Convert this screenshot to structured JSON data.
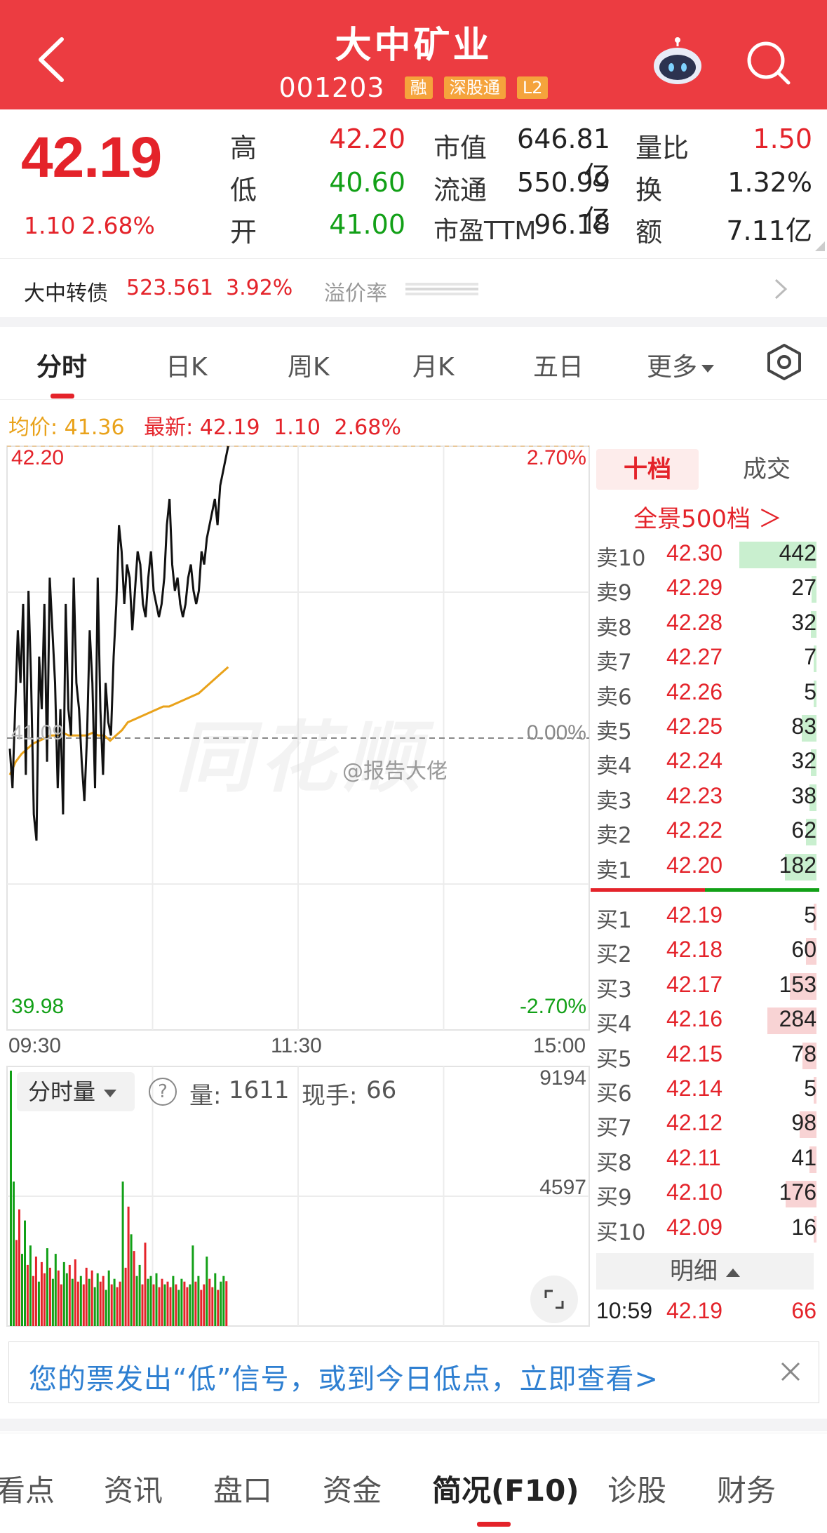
{
  "header": {
    "title": "大中矿业",
    "code": "001203",
    "tags": [
      "融",
      "深股通",
      "L2"
    ]
  },
  "quote": {
    "price": "42.19",
    "change": "1.10",
    "change_pct": "2.68%",
    "high_label": "高",
    "high": "42.20",
    "low_label": "低",
    "low": "40.60",
    "open_label": "开",
    "open": "41.00",
    "mcap_label": "市值",
    "mcap": "646.81亿",
    "float_label": "流通",
    "float": "550.99亿",
    "pe_label": "市盈TTM",
    "pe": "96.18",
    "vr_label": "量比",
    "vr": "1.50",
    "turnover_label": "换",
    "turnover": "1.32%",
    "amount_label": "额",
    "amount": "7.11亿"
  },
  "convertible": {
    "label": "大中转债",
    "price": "523.561",
    "pct": "3.92%",
    "premium_label": "溢价率"
  },
  "tabs": [
    "分时",
    "日K",
    "周K",
    "月K",
    "五日",
    "更多"
  ],
  "avg_bar": {
    "avg_label": "均价:",
    "avg": "41.36",
    "last_label": "最新:",
    "last": "42.19",
    "chg": "1.10",
    "pct": "2.68%"
  },
  "chart_data": {
    "type": "line",
    "title": "",
    "y_left_ticks": [
      "42.20",
      "41.09",
      "39.98"
    ],
    "y_right_ticks": [
      "2.70%",
      "0.00%",
      "-2.70%"
    ],
    "x_ticks": [
      "09:30",
      "11:30",
      "15:00"
    ],
    "ylim": [
      39.98,
      42.2
    ],
    "reference_close": 41.09,
    "series": [
      {
        "values": [
          41.05,
          40.9,
          41.2,
          41.5,
          41.3,
          41.6,
          40.95,
          41.65,
          41.3,
          40.8,
          40.7,
          41.4,
          41.2,
          41.6,
          41.0,
          41.7,
          41.5,
          41.3,
          40.9,
          41.2,
          40.8,
          41.6,
          41.2,
          41.1,
          41.7,
          41.3,
          41.2,
          41.0,
          40.85,
          41.1,
          41.5,
          41.3,
          40.9,
          41.7,
          41.2,
          40.95,
          41.3,
          41.15,
          41.1,
          41.4,
          41.6,
          41.9,
          41.8,
          41.6,
          41.75,
          41.7,
          41.5,
          41.65,
          41.8,
          41.75,
          41.6,
          41.55,
          41.7,
          41.8,
          41.65,
          41.6,
          41.55,
          41.6,
          41.7,
          41.9,
          42.0,
          41.75,
          41.65,
          41.7,
          41.6,
          41.55,
          41.6,
          41.7,
          41.75,
          41.65,
          41.6,
          41.65,
          41.8,
          41.75,
          41.85,
          41.9,
          41.95,
          42.0,
          41.9,
          42.05,
          42.1,
          42.15,
          42.2
        ]
      },
      {
        "values": [
          40.95,
          41.0,
          41.03,
          41.05,
          41.07,
          41.08,
          41.09,
          41.1,
          41.1,
          41.11,
          41.1,
          41.1,
          41.1,
          41.1,
          41.11,
          41.1,
          41.1,
          41.08,
          41.1,
          41.12,
          41.15,
          41.16,
          41.17,
          41.18,
          41.19,
          41.2,
          41.21,
          41.21,
          41.22,
          41.23,
          41.24,
          41.25,
          41.26,
          41.28,
          41.3,
          41.32,
          41.34,
          41.36
        ]
      }
    ]
  },
  "watermark": "同花顺",
  "weibo": "@报告大佬",
  "volume": {
    "selector": "分时量",
    "vol_label": "量:",
    "vol": "1611",
    "hand_label": "现手:",
    "hand": "66",
    "ticks": [
      "9194",
      "4597"
    ],
    "bars": [
      9194,
      5200,
      3100,
      4200,
      2600,
      3800,
      2200,
      2900,
      1800,
      2500,
      1600,
      2300,
      1900,
      2800,
      2100,
      1700,
      2600,
      2000,
      1500,
      2300,
      1900,
      2200,
      1700,
      2400,
      1600,
      1800,
      1500,
      2100,
      1700,
      2000,
      1400,
      1900,
      1600,
      1800,
      1300,
      2000,
      1500,
      1700,
      1400,
      1600,
      5200,
      2100,
      4300,
      3300,
      2700,
      1800,
      2200,
      1500,
      3000,
      1700,
      1800,
      1500,
      1900,
      1400,
      1700,
      1500,
      1600,
      1400,
      1800,
      1500,
      1300,
      1700,
      1600,
      1400,
      1500,
      2900,
      1600,
      1800,
      1300,
      1500,
      2500,
      1700,
      1400,
      1900,
      1300,
      1600,
      1800,
      1611
    ]
  },
  "orderbook": {
    "tab1": "十档",
    "tab2": "成交",
    "panorama": "全景500档 ＞",
    "asks": [
      {
        "label": "卖10",
        "price": "42.30",
        "vol": "442",
        "frac": 1.0
      },
      {
        "label": "卖9",
        "price": "42.29",
        "vol": "27",
        "frac": 0.06
      },
      {
        "label": "卖8",
        "price": "42.28",
        "vol": "32",
        "frac": 0.07
      },
      {
        "label": "卖7",
        "price": "42.27",
        "vol": "7",
        "frac": 0.02
      },
      {
        "label": "卖6",
        "price": "42.26",
        "vol": "5",
        "frac": 0.01
      },
      {
        "label": "卖5",
        "price": "42.25",
        "vol": "83",
        "frac": 0.19
      },
      {
        "label": "卖4",
        "price": "42.24",
        "vol": "32",
        "frac": 0.07
      },
      {
        "label": "卖3",
        "price": "42.23",
        "vol": "38",
        "frac": 0.09
      },
      {
        "label": "卖2",
        "price": "42.22",
        "vol": "62",
        "frac": 0.14
      },
      {
        "label": "卖1",
        "price": "42.20",
        "vol": "182",
        "frac": 0.41
      }
    ],
    "bids": [
      {
        "label": "买1",
        "price": "42.19",
        "vol": "5",
        "frac": 0.01
      },
      {
        "label": "买2",
        "price": "42.18",
        "vol": "60",
        "frac": 0.14
      },
      {
        "label": "买3",
        "price": "42.17",
        "vol": "153",
        "frac": 0.35
      },
      {
        "label": "买4",
        "price": "42.16",
        "vol": "284",
        "frac": 0.64
      },
      {
        "label": "买5",
        "price": "42.15",
        "vol": "78",
        "frac": 0.18
      },
      {
        "label": "买6",
        "price": "42.14",
        "vol": "5",
        "frac": 0.01
      },
      {
        "label": "买7",
        "price": "42.12",
        "vol": "98",
        "frac": 0.22
      },
      {
        "label": "买8",
        "price": "42.11",
        "vol": "41",
        "frac": 0.09
      },
      {
        "label": "买9",
        "price": "42.10",
        "vol": "176",
        "frac": 0.4
      },
      {
        "label": "买10",
        "price": "42.09",
        "vol": "16",
        "frac": 0.04
      }
    ],
    "detail": "明细",
    "trade": {
      "time": "10:59",
      "price": "42.19",
      "vol": "66"
    }
  },
  "notice": {
    "text": "您的票发出“低”信号，或到今日低点，立即查看>"
  },
  "bottom_nav": [
    "看点",
    "资讯",
    "盘口",
    "资金",
    "简况(F10)",
    "诊股",
    "财务"
  ],
  "colors": {
    "brand": "#ec3c41",
    "up": "#e4232a",
    "down": "#12a017",
    "avg_line": "#e9a21a",
    "ask_bar": "#c9efcf",
    "bid_bar": "#f8d3d4",
    "link": "#2e7fd1"
  }
}
